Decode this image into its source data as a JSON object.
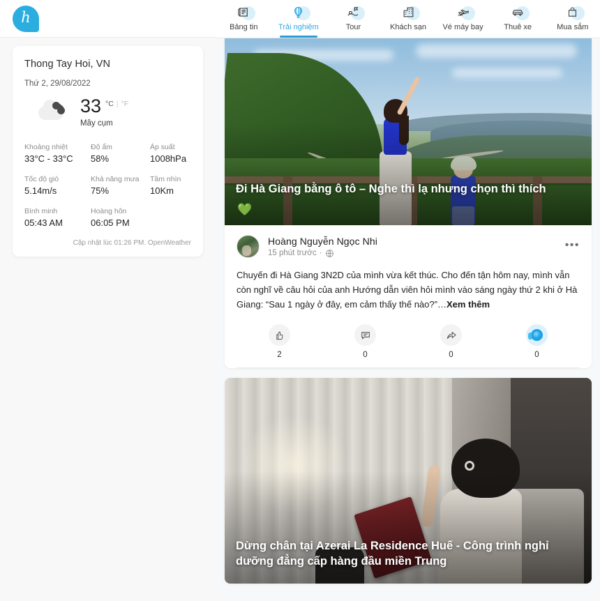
{
  "brand": {
    "logo_letter": "h",
    "logo_color": "#2bade0",
    "name": "brand-logo"
  },
  "weather": {
    "city": "Thong Tay Hoi, VN",
    "date": "Thứ 2, 29/08/2022",
    "temperature": "33",
    "unit_celsius": "°C",
    "unit_fahrenheit": "°F",
    "unit_separator": "|",
    "condition": "Mây cụm",
    "icon": "broken-clouds-icon",
    "metrics": [
      {
        "label": "Khoảng nhiệt",
        "value": "33°C - 33°C"
      },
      {
        "label": "Độ ẩm",
        "value": "58%"
      },
      {
        "label": "Áp suất",
        "value": "1008hPa"
      },
      {
        "label": "Tốc độ gió",
        "value": "5.14m/s"
      },
      {
        "label": "Khả năng mưa",
        "value": "75%"
      },
      {
        "label": "Tầm nhìn",
        "value": "10Km"
      },
      {
        "label": "Bình minh",
        "value": "05:43 AM"
      },
      {
        "label": "Hoàng hôn",
        "value": "06:05 PM"
      }
    ],
    "updated": "Cập nhật lúc 01:26 PM. OpenWeather"
  },
  "nav": {
    "active_index": 1,
    "active_color": "#2eaae0",
    "items": [
      {
        "label": "Bảng tin",
        "icon": "newspaper-icon"
      },
      {
        "label": "Trải nghiệm",
        "icon": "hot-air-balloon-icon"
      },
      {
        "label": "Tour",
        "icon": "tour-signpost-icon"
      },
      {
        "label": "Khách sạn",
        "icon": "hotel-building-icon"
      },
      {
        "label": "Vé máy bay",
        "icon": "airplane-icon"
      },
      {
        "label": "Thuê xe",
        "icon": "car-icon"
      },
      {
        "label": "Mua sắm",
        "icon": "shopping-bag-icon"
      }
    ]
  },
  "feed": {
    "posts": [
      {
        "hero_title": "Đi Hà Giang bằng ô tô – Nghe thì lạ nhưng chọn thì thích",
        "hero_badge": "💚",
        "author": "Hoàng Nguyễn Ngọc Nhi",
        "time": "15 phút trước",
        "privacy_icon": "globe-icon",
        "time_separator": "·",
        "more_menu": "•••",
        "text": "Chuyến đi Hà Giang 3N2D của mình vừa kết thúc. Cho đến tận hôm nay, mình vẫn còn nghĩ về câu hỏi của anh Hướng dẫn viên hỏi mình vào sáng ngày thứ 2 khi ở Hà Giang: “Sau 1 ngày ở đây, em cảm thấy thế nào?”…",
        "see_more": "Xem thêm",
        "actions": [
          {
            "icon": "like-hand-icon",
            "count": "2"
          },
          {
            "icon": "comment-icon",
            "count": "0"
          },
          {
            "icon": "share-icon",
            "count": "0"
          },
          {
            "icon": "save-icon",
            "count": "0"
          }
        ]
      },
      {
        "hero_title": "Dừng chân tại Azerai La Residence Huế - Công trình nghỉ dưỡng đẳng cấp hàng đầu miền Trung"
      }
    ]
  }
}
